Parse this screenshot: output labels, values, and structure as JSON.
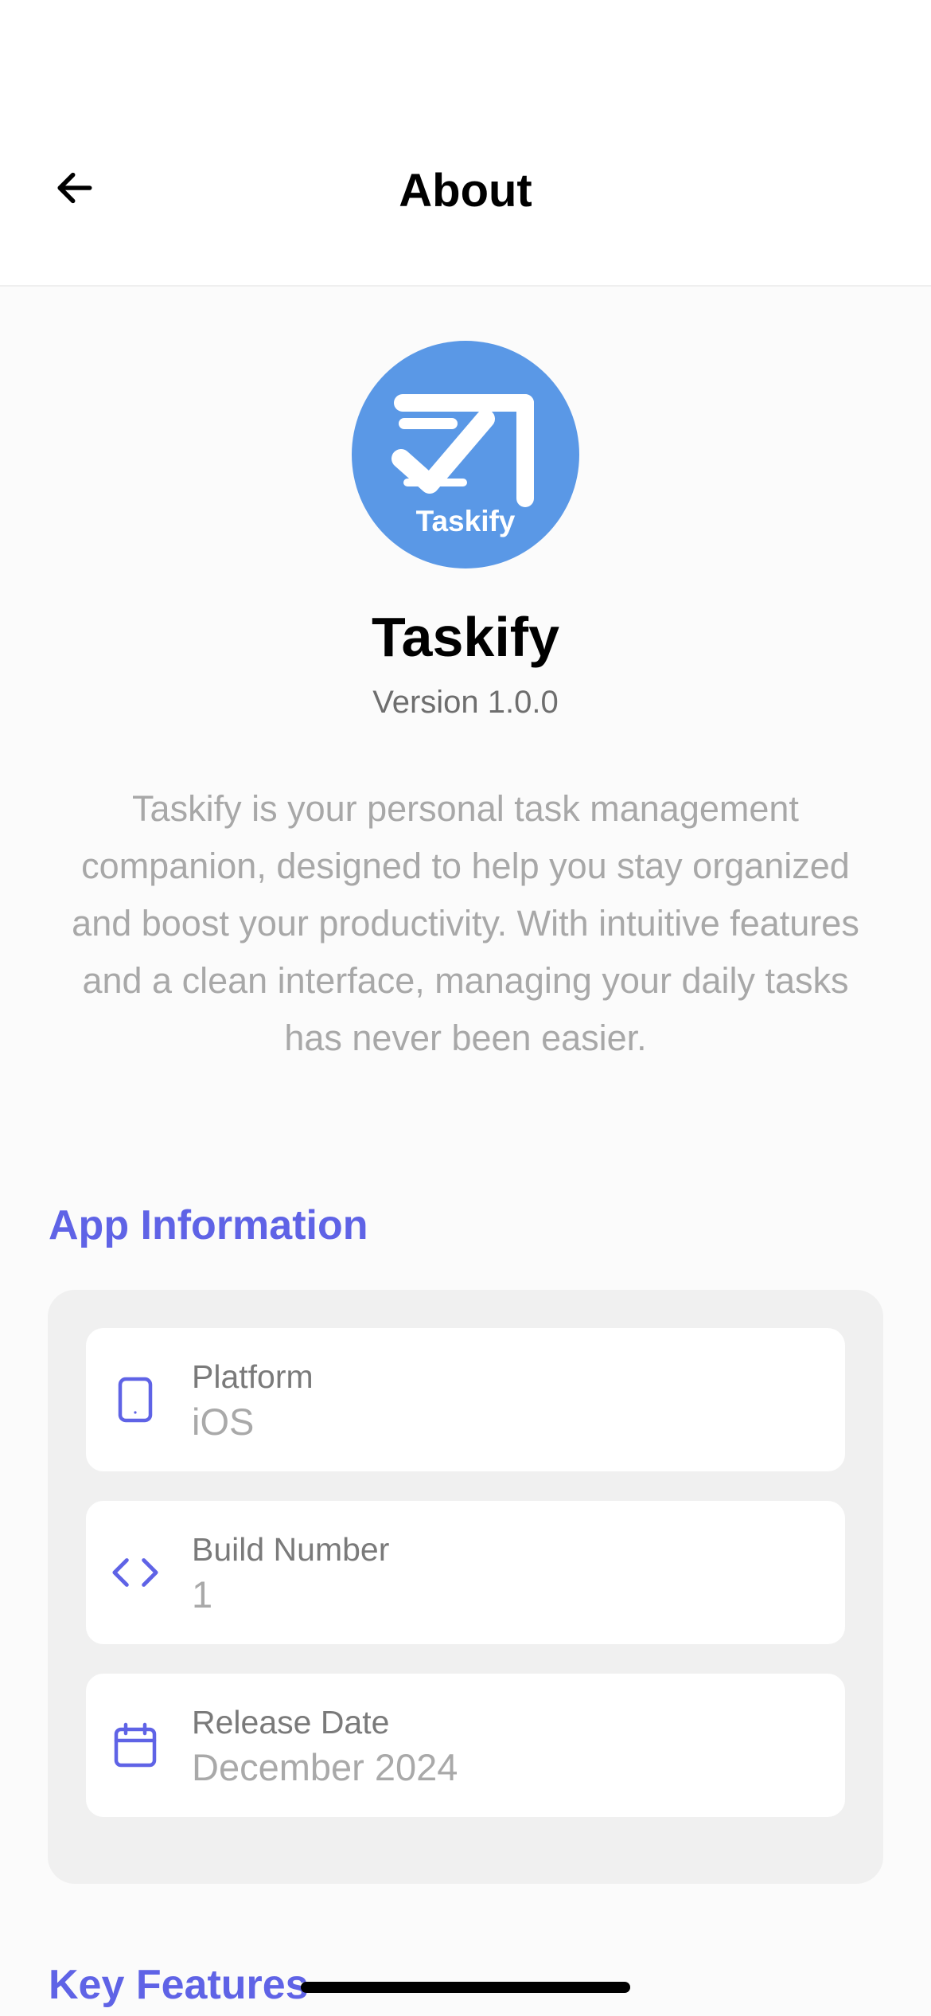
{
  "header": {
    "title": "About"
  },
  "app": {
    "logo_text": "Taskify",
    "name": "Taskify",
    "version": "Version 1.0.0",
    "description": "Taskify is your personal task management companion, designed to help you stay organized and boost your productivity. With intuitive features and a clean interface, managing your daily tasks has never been easier."
  },
  "app_information": {
    "title": "App Information",
    "rows": [
      {
        "icon": "tablet-icon",
        "label": "Platform",
        "value": "iOS"
      },
      {
        "icon": "code-icon",
        "label": "Build Number",
        "value": "1"
      },
      {
        "icon": "calendar-icon",
        "label": "Release Date",
        "value": "December 2024"
      }
    ]
  },
  "key_features": {
    "title": "Key Features"
  },
  "colors": {
    "accent": "#5f63e6",
    "logo_background": "#5a98e6",
    "card_background": "#f0f0f0"
  }
}
